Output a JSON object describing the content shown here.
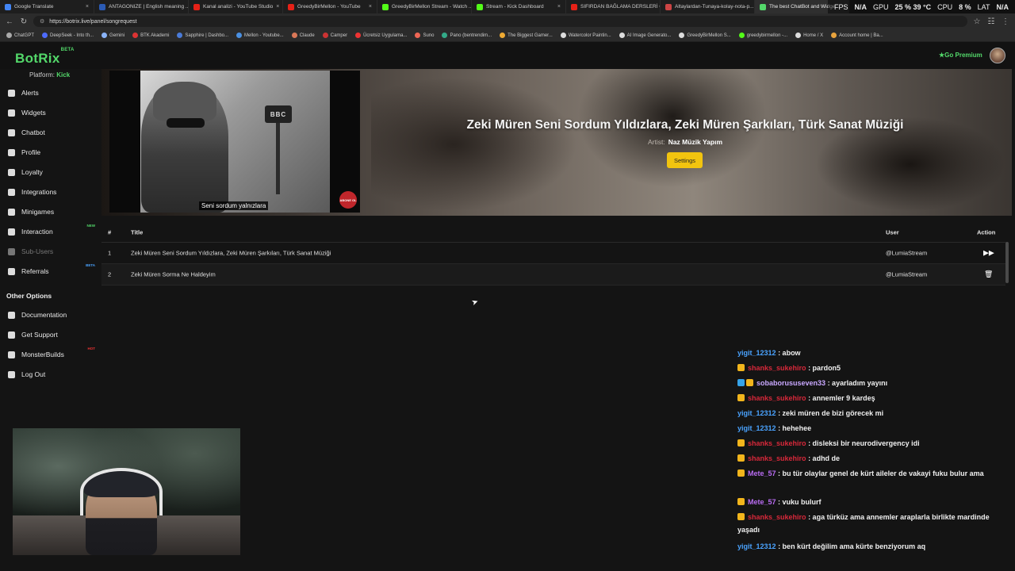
{
  "browser": {
    "tabs": [
      {
        "label": "Google Translate",
        "color": "#4285f4"
      },
      {
        "label": "ANTAGONIZE | English meaning ...",
        "color": "#2b5bb5"
      },
      {
        "label": "Kanal analizi - YouTube Studio",
        "color": "#e62117"
      },
      {
        "label": "GreedyBirMellon - YouTube",
        "color": "#e62117"
      },
      {
        "label": "GreedyBirMellon Stream - Watch ...",
        "color": "#53fc18"
      },
      {
        "label": "Stream - Kick Dashboard",
        "color": "#53fc18"
      },
      {
        "label": "SIFIRDAN BAĞLAMA DERSLERİ 6 ...",
        "color": "#e62117"
      },
      {
        "label": "Altaylardan-Tunaya-kolay-nota-p...",
        "color": "#c44"
      },
      {
        "label": "The best ChatBot and Widge...",
        "color": "#53d86a"
      }
    ],
    "hud": {
      "fps_label": "FPS",
      "fps_value": "N/A",
      "gpu_label": "GPU",
      "gpu_value": "25 %  39 °C",
      "cpu_label": "CPU",
      "cpu_value": "8 %",
      "lat_label": "LAT",
      "lat_value": "N/A"
    },
    "url": "https://botrix.live/panel/songrequest",
    "bookmarks": [
      {
        "label": "ChatGPT",
        "color": "#aaa"
      },
      {
        "label": "DeepSeek - Into th...",
        "color": "#4d6bfe"
      },
      {
        "label": "Gemini",
        "color": "#8ab4f8"
      },
      {
        "label": "BTK Akademi",
        "color": "#d33"
      },
      {
        "label": "Sapphire | Dashbo...",
        "color": "#4a7bd8"
      },
      {
        "label": "Mellon - Youtube...",
        "color": "#4a90e2"
      },
      {
        "label": "Claude",
        "color": "#d97757"
      },
      {
        "label": "Camper",
        "color": "#c33"
      },
      {
        "label": "Ücretsiz Uygulama...",
        "color": "#e33"
      },
      {
        "label": "Suno",
        "color": "#e65"
      },
      {
        "label": "Pano (bentrendim...",
        "color": "#3a8"
      },
      {
        "label": "The Biggest Gamer...",
        "color": "#ea3"
      },
      {
        "label": "Watercolor Paintin...",
        "color": "#ddd"
      },
      {
        "label": "AI Image Generato...",
        "color": "#ddd"
      },
      {
        "label": "GreedyBirMellon S...",
        "color": "#ddd"
      },
      {
        "label": "greedybirmellon -...",
        "color": "#53fc18"
      },
      {
        "label": "Home / X",
        "color": "#ddd"
      },
      {
        "label": "Account home | Ba...",
        "color": "#e8a33d"
      }
    ]
  },
  "header": {
    "logo": "BotRix",
    "logo_badge": "BETA",
    "premium": "Go Premium"
  },
  "sidebar": {
    "platform_label": "Platform:",
    "platform_value": "Kick",
    "items": [
      {
        "label": "Alerts",
        "icon": "warning-icon"
      },
      {
        "label": "Widgets",
        "icon": "grid-icon"
      },
      {
        "label": "Chatbot",
        "icon": "chat-icon"
      },
      {
        "label": "Profile",
        "icon": "profile-icon"
      },
      {
        "label": "Loyalty",
        "icon": "trophy-icon"
      },
      {
        "label": "Integrations",
        "icon": "plug-icon"
      },
      {
        "label": "Minigames",
        "icon": "gamepad-icon"
      },
      {
        "label": "Interaction",
        "icon": "music-icon",
        "badge": "NEW"
      },
      {
        "label": "Sub-Users",
        "icon": "users-icon"
      },
      {
        "label": "Referrals",
        "icon": "referrals-icon",
        "badge": "BETA"
      }
    ],
    "other_title": "Other Options",
    "other_items": [
      {
        "label": "Documentation",
        "icon": "book-icon"
      },
      {
        "label": "Get Support",
        "icon": "help-icon"
      },
      {
        "label": "MonsterBuilds",
        "icon": "monitor-icon",
        "badge": "HOT"
      },
      {
        "label": "Log Out",
        "icon": "logout-icon"
      }
    ]
  },
  "now_playing": {
    "title": "Zeki Müren Seni Sordum Yıldızlara, Zeki Müren Şarkıları, Türk Sanat Müziği",
    "artist_label": "Artist:",
    "artist": "Naz Müzik Yapım",
    "settings_label": "Settings",
    "thumbnail_caption": "Seni sordum yalnızlara",
    "thumbnail_sign": "BBC",
    "thumbnail_logo": "ABONE OL"
  },
  "queue": {
    "headers": {
      "num": "#",
      "title": "Title",
      "user": "User",
      "action": "Action"
    },
    "rows": [
      {
        "num": "1",
        "title": "Zeki Müren Seni Sordum Yıldızlara, Zeki Müren Şarkıları, Türk Sanat Müziği",
        "user": "@LumiaStream",
        "action_icon": "skip-forward-icon"
      },
      {
        "num": "2",
        "title": "Zeki Müren Sorma Ne Haldeyim",
        "user": "@LumiaStream",
        "action_icon": "trash-icon"
      }
    ]
  },
  "chat": [
    {
      "user": "yigit_12312",
      "text": ": abow",
      "color": "blue",
      "badges": 0
    },
    {
      "user": "shanks_sukehiro",
      "text": ": pardon5",
      "color": "red",
      "badges": 1
    },
    {
      "user": "sobaborususeven33",
      "text": ": ayarladım yayını",
      "color": "lav",
      "badges": 2
    },
    {
      "user": "shanks_sukehiro",
      "text": ": annemler 9 kardeş",
      "color": "red",
      "badges": 1
    },
    {
      "user": "yigit_12312",
      "text": ": zeki müren de bizi görecek mi",
      "color": "blue",
      "badges": 0
    },
    {
      "user": "yigit_12312",
      "text": ": hehehee",
      "color": "blue",
      "badges": 0
    },
    {
      "user": "shanks_sukehiro",
      "text": ": disleksi bir neurodivergency idi",
      "color": "red",
      "badges": 1
    },
    {
      "user": "shanks_sukehiro",
      "text": ": adhd de",
      "color": "red",
      "badges": 1
    },
    {
      "user": "Mete_57",
      "text": ": bu tür olaylar genel de kürt aileler de vakayi fuku bulur ama",
      "color": "purple",
      "badges": 1
    },
    {
      "user": "Mete_57",
      "text": ": vuku bulurf",
      "color": "purple",
      "badges": 1
    },
    {
      "user": "shanks_sukehiro",
      "text": ": aga türküz ama annemler araplarla birlikte mardinde yaşadı",
      "color": "red",
      "badges": 1
    },
    {
      "user": "yigit_12312",
      "text": ": ben kürt değilim ama kürte benziyorum aq",
      "color": "blue",
      "badges": 0
    }
  ]
}
